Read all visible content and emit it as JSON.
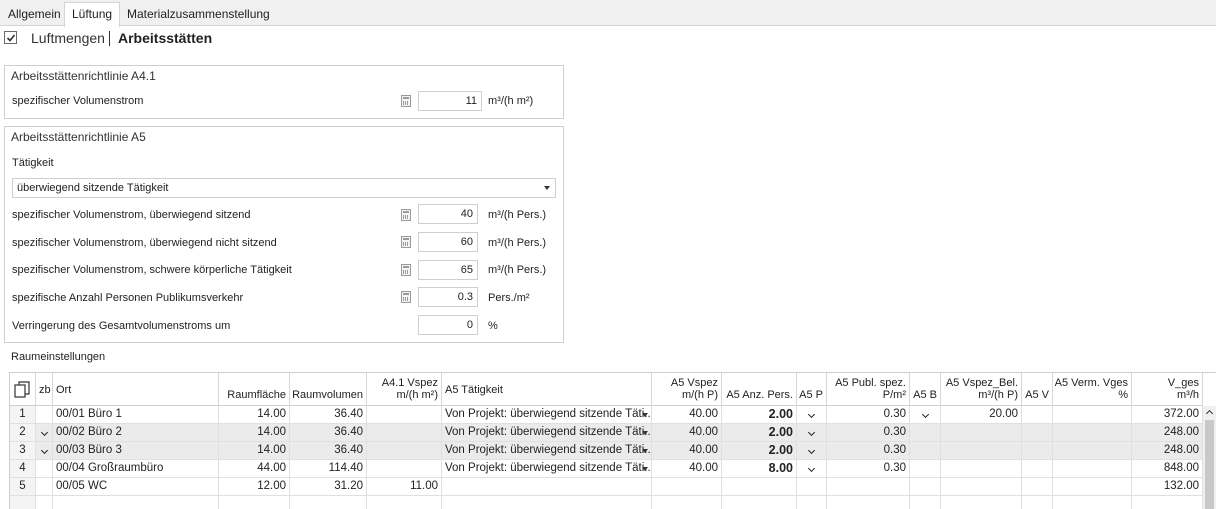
{
  "tabs": [
    "Allgemein",
    "Lüftung",
    "Materialzusammenstellung"
  ],
  "header": {
    "checked": true,
    "title1": "Luftmengen",
    "title2": "Arbeitsstätten"
  },
  "a41": {
    "title": "Arbeitsstättenrichtlinie A4.1",
    "label": "spezifischer Volumenstrom",
    "value": "11",
    "unit": "m³/(h m²)"
  },
  "a5": {
    "title": "Arbeitsstättenrichtlinie A5",
    "taetigkeit_label": "Tätigkeit",
    "taetigkeit_value": "überwiegend sitzende Tätigkeit",
    "rows": [
      {
        "label": "spezifischer Volumenstrom, überwiegend sitzend",
        "value": "40",
        "unit": "m³/(h Pers.)",
        "icon": true
      },
      {
        "label": "spezifischer Volumenstrom, überwiegend nicht sitzend",
        "value": "60",
        "unit": "m³/(h Pers.)",
        "icon": true
      },
      {
        "label": "spezifischer Volumenstrom, schwere körperliche Tätigkeit",
        "value": "65",
        "unit": "m³/(h Pers.)",
        "icon": true
      },
      {
        "label": "spezifische Anzahl Personen Publikumsverkehr",
        "value": "0.3",
        "unit": "Pers./m²",
        "icon": true
      },
      {
        "label": "Verringerung des Gesamtvolumenstroms um",
        "value": "0",
        "unit": "%",
        "icon": false
      }
    ]
  },
  "raum": {
    "title": "Raumeinstellungen",
    "columns": [
      {
        "l1": "",
        "l2": ""
      },
      {
        "l1": "",
        "l2": "zb"
      },
      {
        "l1": "",
        "l2": "Ort"
      },
      {
        "l1": "",
        "l2": "Raumfläche"
      },
      {
        "l1": "",
        "l2": "Raumvolumen"
      },
      {
        "l1": "A4.1 Vspez",
        "l2": "m/(h m²)"
      },
      {
        "l1": "",
        "l2": "A5 Tätigkeit"
      },
      {
        "l1": "A5 Vspez",
        "l2": "m/(h P)"
      },
      {
        "l1": "",
        "l2": "A5 Anz. Pers."
      },
      {
        "l1": "",
        "l2": "A5 P"
      },
      {
        "l1": "A5 Publ. spez.",
        "l2": "P/m²"
      },
      {
        "l1": "",
        "l2": "A5 B"
      },
      {
        "l1": "A5 Vspez_Bel.",
        "l2": "m³/(h P)"
      },
      {
        "l1": "",
        "l2": "A5 V"
      },
      {
        "l1": "A5 Verm. Vges",
        "l2": "%"
      },
      {
        "l1": "V_ges",
        "l2": "m³/h"
      }
    ],
    "rows": [
      {
        "nr": "1",
        "zb": false,
        "ort": "00/01 Büro 1",
        "flaeche": "14.00",
        "volumen": "36.40",
        "a41": "",
        "taet": "Von Projekt: überwiegend sitzende Täti...",
        "vspez": "40.00",
        "anz": "2.00",
        "p": true,
        "publ": "0.30",
        "b": true,
        "vspezbel": "20.00",
        "v": "",
        "verm": "",
        "vges": "372.00",
        "gray": false
      },
      {
        "nr": "2",
        "zb": true,
        "ort": "00/02 Büro 2",
        "flaeche": "14.00",
        "volumen": "36.40",
        "a41": "",
        "taet": "Von Projekt: überwiegend sitzende Täti...",
        "vspez": "40.00",
        "anz": "2.00",
        "p": true,
        "publ": "0.30",
        "b": false,
        "vspezbel": "",
        "v": "",
        "verm": "",
        "vges": "248.00",
        "gray": true
      },
      {
        "nr": "3",
        "zb": true,
        "ort": "00/03 Büro 3",
        "flaeche": "14.00",
        "volumen": "36.40",
        "a41": "",
        "taet": "Von Projekt: überwiegend sitzende Täti...",
        "vspez": "40.00",
        "anz": "2.00",
        "p": true,
        "publ": "0.30",
        "b": false,
        "vspezbel": "",
        "v": "",
        "verm": "",
        "vges": "248.00",
        "gray": true
      },
      {
        "nr": "4",
        "zb": false,
        "ort": "00/04 Großraumbüro",
        "flaeche": "44.00",
        "volumen": "114.40",
        "a41": "",
        "taet": "Von Projekt: überwiegend sitzende Täti...",
        "vspez": "40.00",
        "anz": "8.00",
        "p": true,
        "publ": "0.30",
        "b": false,
        "vspezbel": "",
        "v": "",
        "verm": "",
        "vges": "848.00",
        "gray": false
      },
      {
        "nr": "5",
        "zb": false,
        "ort": "00/05 WC",
        "flaeche": "12.00",
        "volumen": "31.20",
        "a41": "11.00",
        "taet": "",
        "vspez": "",
        "anz": "",
        "p": false,
        "publ": "",
        "b": false,
        "vspezbel": "",
        "v": "",
        "verm": "",
        "vges": "132.00",
        "gray": false
      }
    ]
  }
}
